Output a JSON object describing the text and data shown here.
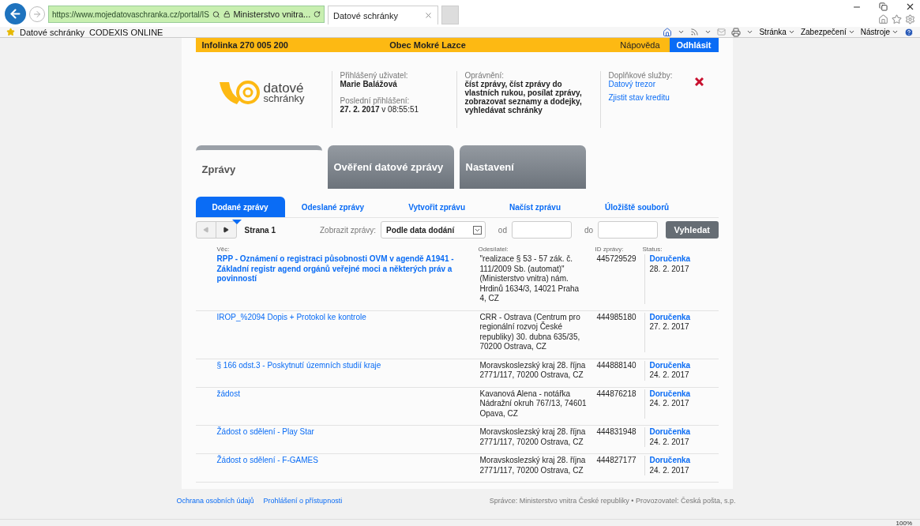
{
  "browser": {
    "address": {
      "url": "https://www.mojedatovaschranka.cz/portal/IS",
      "site": "Ministerstvo vnitra..."
    },
    "tabs": [
      {
        "title": "Datové schránky",
        "selected": true
      }
    ],
    "favorites": [
      "Datové schránky",
      "CODEXIS ONLINE"
    ],
    "commands": [
      "Stránka",
      "Zabezpečení",
      "Nástroje"
    ],
    "zoom": "100%"
  },
  "topbar": {
    "hotline": "Infolinka 270 005 200",
    "organization": "Obec Mokré Lazce",
    "help": "Nápověda",
    "logout": "Odhlásit"
  },
  "logo": {
    "line1": "datové",
    "line2": "schránky"
  },
  "user": {
    "label": "Přihlášený uživatel:",
    "name": "Marie Balážová",
    "last_login_label": "Poslední přihlášení:",
    "last_login": "**27. 2. 2017** v 08:55:51"
  },
  "permissions": {
    "label": "Oprávnění:",
    "text": "číst zprávy, číst zprávy do vlastních rukou, posílat zprávy, zobrazovat seznamy a dodejky, vyhledávat schránky"
  },
  "services": {
    "label": "Doplňkové služby:",
    "links": [
      "Datový trezor",
      "Zjistit stav kreditu"
    ]
  },
  "main_tabs": [
    {
      "label": "Zprávy",
      "selected": true
    },
    {
      "label": "Ověření datové zprávy",
      "selected": false
    },
    {
      "label": "Nastavení",
      "selected": false
    }
  ],
  "sub_tabs": [
    {
      "label": "Dodané zprávy",
      "selected": true
    },
    {
      "label": "Odeslané zprávy",
      "selected": false
    },
    {
      "label": "Vytvořit zprávu",
      "selected": false
    },
    {
      "label": "Načíst zprávu",
      "selected": false
    },
    {
      "label": "Úložiště souborů",
      "selected": false
    }
  ],
  "toolbar": {
    "page": "Strana 1",
    "filter_label": "Zobrazit zprávy:",
    "filter_value": "Podle data dodání",
    "from_label": "od",
    "to_label": "do",
    "search": "Vyhledat"
  },
  "table": {
    "columns": [
      "Věc:",
      "Odesílatel:",
      "ID zprávy:",
      "Status:"
    ],
    "rows": [
      {
        "subject": "RPP - Oznámení o registraci působnosti OVM v agendě A1941 - Základní registr agend orgánů veřejné moci a některých práv a povinností",
        "unread": true,
        "sender": "\"realizace § 53 - 57 zák. č. 111/2009 Sb. (automat)\" (Ministerstvo vnitra) nám. Hrdinů 1634/3, 14021 Praha 4, CZ",
        "id": "445729529",
        "status": "Doručenka",
        "date": "28. 2. 2017"
      },
      {
        "subject": "IROP_%2094 Dopis + Protokol ke kontrole",
        "unread": false,
        "sender": "CRR - Ostrava (Centrum pro regionální rozvoj České republiky) 30. dubna 635/35, 70200 Ostrava, CZ",
        "id": "444985180",
        "status": "Doručenka",
        "date": "27. 2. 2017"
      },
      {
        "subject": "§ 166 odst.3 - Poskytnutí územních studií kraje",
        "unread": false,
        "sender": "Moravskoslezský kraj 28. října 2771/117, 70200 Ostrava, CZ",
        "id": "444888140",
        "status": "Doručenka",
        "date": "24. 2. 2017"
      },
      {
        "subject": "žádost",
        "unread": false,
        "sender": "Kavanová Alena - notářka Nádražní okruh 767/13, 74601 Opava, CZ",
        "id": "444876218",
        "status": "Doručenka",
        "date": "24. 2. 2017"
      },
      {
        "subject": "Žádost o sdělení - Play Star",
        "unread": false,
        "sender": "Moravskoslezský kraj 28. října 2771/117, 70200 Ostrava, CZ",
        "id": "444831948",
        "status": "Doručenka",
        "date": "24. 2. 2017"
      },
      {
        "subject": "Žádost o sdělení - F-GAMES",
        "unread": false,
        "sender": "Moravskoslezský kraj 28. října 2771/117, 70200 Ostrava, CZ",
        "id": "444827177",
        "status": "Doručenka",
        "date": "24. 2. 2017"
      }
    ]
  },
  "footer": {
    "links": [
      "Ochrana osobních údajů",
      "Prohlášení o přístupnosti"
    ],
    "credit": "Správce: Ministerstvo vnitra České republiky • Provozovatel: Česká pošta, s.p."
  }
}
